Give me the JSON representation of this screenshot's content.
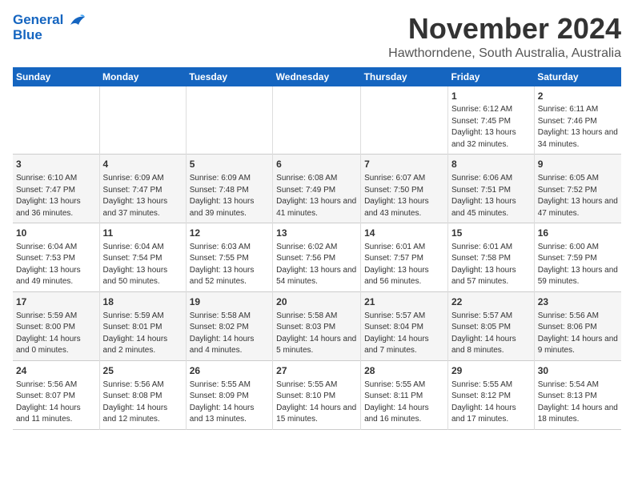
{
  "logo": {
    "line1": "General",
    "line2": "Blue"
  },
  "title": "November 2024",
  "subtitle": "Hawthorndene, South Australia, Australia",
  "weekdays": [
    "Sunday",
    "Monday",
    "Tuesday",
    "Wednesday",
    "Thursday",
    "Friday",
    "Saturday"
  ],
  "weeks": [
    [
      {
        "day": "",
        "info": ""
      },
      {
        "day": "",
        "info": ""
      },
      {
        "day": "",
        "info": ""
      },
      {
        "day": "",
        "info": ""
      },
      {
        "day": "",
        "info": ""
      },
      {
        "day": "1",
        "info": "Sunrise: 6:12 AM\nSunset: 7:45 PM\nDaylight: 13 hours\nand 32 minutes."
      },
      {
        "day": "2",
        "info": "Sunrise: 6:11 AM\nSunset: 7:46 PM\nDaylight: 13 hours\nand 34 minutes."
      }
    ],
    [
      {
        "day": "3",
        "info": "Sunrise: 6:10 AM\nSunset: 7:47 PM\nDaylight: 13 hours\nand 36 minutes."
      },
      {
        "day": "4",
        "info": "Sunrise: 6:09 AM\nSunset: 7:47 PM\nDaylight: 13 hours\nand 37 minutes."
      },
      {
        "day": "5",
        "info": "Sunrise: 6:09 AM\nSunset: 7:48 PM\nDaylight: 13 hours\nand 39 minutes."
      },
      {
        "day": "6",
        "info": "Sunrise: 6:08 AM\nSunset: 7:49 PM\nDaylight: 13 hours\nand 41 minutes."
      },
      {
        "day": "7",
        "info": "Sunrise: 6:07 AM\nSunset: 7:50 PM\nDaylight: 13 hours\nand 43 minutes."
      },
      {
        "day": "8",
        "info": "Sunrise: 6:06 AM\nSunset: 7:51 PM\nDaylight: 13 hours\nand 45 minutes."
      },
      {
        "day": "9",
        "info": "Sunrise: 6:05 AM\nSunset: 7:52 PM\nDaylight: 13 hours\nand 47 minutes."
      }
    ],
    [
      {
        "day": "10",
        "info": "Sunrise: 6:04 AM\nSunset: 7:53 PM\nDaylight: 13 hours\nand 49 minutes."
      },
      {
        "day": "11",
        "info": "Sunrise: 6:04 AM\nSunset: 7:54 PM\nDaylight: 13 hours\nand 50 minutes."
      },
      {
        "day": "12",
        "info": "Sunrise: 6:03 AM\nSunset: 7:55 PM\nDaylight: 13 hours\nand 52 minutes."
      },
      {
        "day": "13",
        "info": "Sunrise: 6:02 AM\nSunset: 7:56 PM\nDaylight: 13 hours\nand 54 minutes."
      },
      {
        "day": "14",
        "info": "Sunrise: 6:01 AM\nSunset: 7:57 PM\nDaylight: 13 hours\nand 56 minutes."
      },
      {
        "day": "15",
        "info": "Sunrise: 6:01 AM\nSunset: 7:58 PM\nDaylight: 13 hours\nand 57 minutes."
      },
      {
        "day": "16",
        "info": "Sunrise: 6:00 AM\nSunset: 7:59 PM\nDaylight: 13 hours\nand 59 minutes."
      }
    ],
    [
      {
        "day": "17",
        "info": "Sunrise: 5:59 AM\nSunset: 8:00 PM\nDaylight: 14 hours\nand 0 minutes."
      },
      {
        "day": "18",
        "info": "Sunrise: 5:59 AM\nSunset: 8:01 PM\nDaylight: 14 hours\nand 2 minutes."
      },
      {
        "day": "19",
        "info": "Sunrise: 5:58 AM\nSunset: 8:02 PM\nDaylight: 14 hours\nand 4 minutes."
      },
      {
        "day": "20",
        "info": "Sunrise: 5:58 AM\nSunset: 8:03 PM\nDaylight: 14 hours\nand 5 minutes."
      },
      {
        "day": "21",
        "info": "Sunrise: 5:57 AM\nSunset: 8:04 PM\nDaylight: 14 hours\nand 7 minutes."
      },
      {
        "day": "22",
        "info": "Sunrise: 5:57 AM\nSunset: 8:05 PM\nDaylight: 14 hours\nand 8 minutes."
      },
      {
        "day": "23",
        "info": "Sunrise: 5:56 AM\nSunset: 8:06 PM\nDaylight: 14 hours\nand 9 minutes."
      }
    ],
    [
      {
        "day": "24",
        "info": "Sunrise: 5:56 AM\nSunset: 8:07 PM\nDaylight: 14 hours\nand 11 minutes."
      },
      {
        "day": "25",
        "info": "Sunrise: 5:56 AM\nSunset: 8:08 PM\nDaylight: 14 hours\nand 12 minutes."
      },
      {
        "day": "26",
        "info": "Sunrise: 5:55 AM\nSunset: 8:09 PM\nDaylight: 14 hours\nand 13 minutes."
      },
      {
        "day": "27",
        "info": "Sunrise: 5:55 AM\nSunset: 8:10 PM\nDaylight: 14 hours\nand 15 minutes."
      },
      {
        "day": "28",
        "info": "Sunrise: 5:55 AM\nSunset: 8:11 PM\nDaylight: 14 hours\nand 16 minutes."
      },
      {
        "day": "29",
        "info": "Sunrise: 5:55 AM\nSunset: 8:12 PM\nDaylight: 14 hours\nand 17 minutes."
      },
      {
        "day": "30",
        "info": "Sunrise: 5:54 AM\nSunset: 8:13 PM\nDaylight: 14 hours\nand 18 minutes."
      }
    ]
  ]
}
